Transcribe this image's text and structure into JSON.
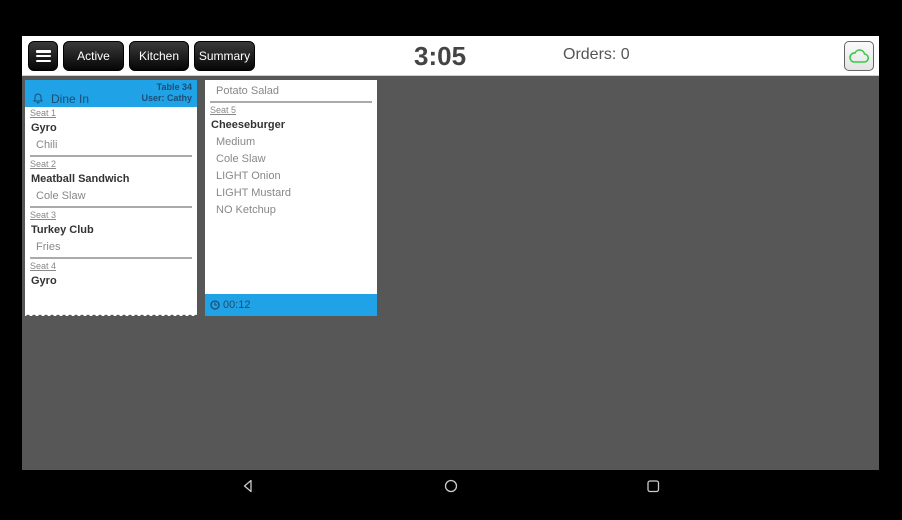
{
  "toolbar": {
    "menu_icon": "hamburger-menu-icon",
    "buttons": [
      "Active",
      "Kitchen",
      "Summary"
    ],
    "clock": "3:05",
    "orders": "Orders: 0",
    "sync_icon": "cloud-icon",
    "sync_color": "#3cc84a"
  },
  "tickets": [
    {
      "header": {
        "type_icon": "bell-icon",
        "type": "Dine In",
        "table": "Table 34",
        "user": "User: Cathy"
      },
      "seats": [
        {
          "seat": "Seat 1",
          "item": "Gyro",
          "mods": [
            "Chili"
          ]
        },
        {
          "seat": "Seat 2",
          "item": "Meatball Sandwich",
          "mods": [
            "Cole Slaw"
          ]
        },
        {
          "seat": "Seat 3",
          "item": "Turkey Club",
          "mods": [
            "Fries"
          ]
        },
        {
          "seat": "Seat 4",
          "item": "Gyro",
          "mods": []
        }
      ]
    },
    {
      "continued_mod": "Potato Salad",
      "seats": [
        {
          "seat": "Seat 5",
          "item": "Cheeseburger",
          "mods": [
            "Medium",
            "Cole Slaw",
            "LIGHT Onion",
            "LIGHT Mustard",
            "NO Ketchup"
          ]
        }
      ],
      "footer": {
        "timer_icon": "clock-icon",
        "elapsed": "00:12"
      }
    }
  ],
  "colors": {
    "accent": "#1fa2e6",
    "background": "#575757"
  },
  "navbar": {
    "icons": [
      "back-icon",
      "home-icon",
      "recents-icon"
    ]
  }
}
